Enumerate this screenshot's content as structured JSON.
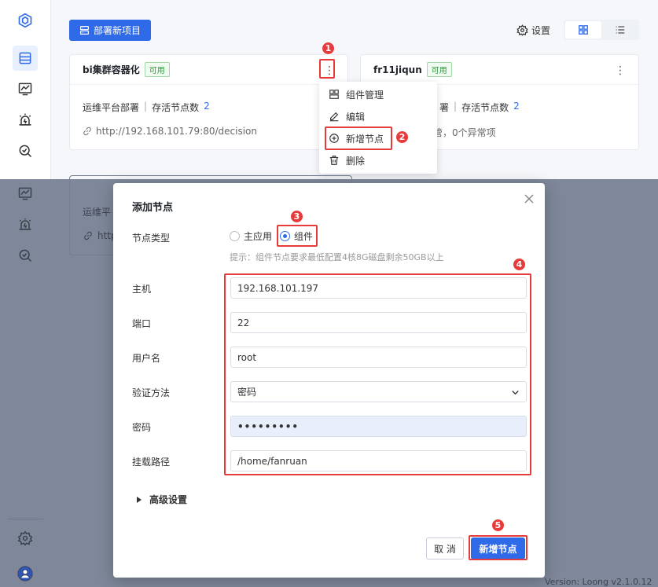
{
  "topbar": {
    "deploy_label": "部署新项目",
    "settings_label": "设置"
  },
  "cards": [
    {
      "title": "bi集群容器化",
      "status": "可用",
      "platform": "运维平台部署",
      "nodes_label": "存活节点数",
      "nodes_count": "2",
      "url": "http://192.168.101.79:80/decision"
    },
    {
      "title": "fr11jiqun",
      "status": "可用",
      "platform_partial": "署",
      "nodes_label": "存活节点数",
      "nodes_count": "2",
      "status_summary_partial": "管，0个异常项"
    }
  ],
  "menu": {
    "items": [
      {
        "label": "组件管理",
        "icon": "components-icon"
      },
      {
        "label": "编辑",
        "icon": "edit-icon"
      },
      {
        "label": "新增节点",
        "icon": "add-circle-icon"
      },
      {
        "label": "删除",
        "icon": "trash-icon"
      }
    ]
  },
  "background": {
    "ghost_text_1": "运维平",
    "ghost_text_2": "http"
  },
  "modal": {
    "title": "添加节点",
    "node_type_label": "节点类型",
    "node_type_options": [
      "主应用",
      "组件"
    ],
    "node_type_selected": "组件",
    "hint": "提示：组件节点要求最低配置4核8G磁盘剩余50GB以上",
    "fields": {
      "host_label": "主机",
      "host_value": "192.168.101.197",
      "port_label": "端口",
      "port_value": "22",
      "user_label": "用户名",
      "user_value": "root",
      "auth_label": "验证方法",
      "auth_value": "密码",
      "password_label": "密码",
      "password_value": "•••••••••",
      "mount_label": "挂载路径",
      "mount_value": "/home/fanruan"
    },
    "advanced_label": "高级设置",
    "cancel_label": "取 消",
    "submit_label": "新增节点"
  },
  "steps": [
    "1",
    "2",
    "3",
    "4",
    "5"
  ],
  "footer": {
    "version": "Version: Loong v2.1.0.12"
  },
  "colors": {
    "primary": "#2f6be8",
    "highlight": "#e73a3a",
    "available": "#2a9a3d"
  }
}
